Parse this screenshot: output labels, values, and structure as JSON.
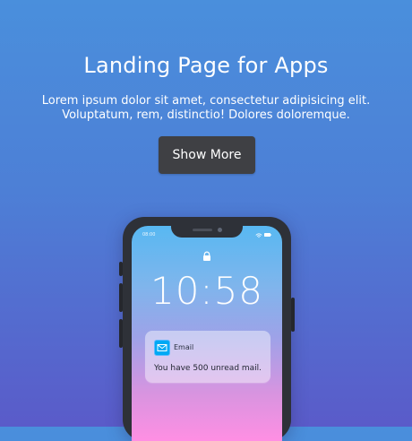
{
  "hero": {
    "title": "Landing Page for Apps",
    "subtitle": "Lorem ipsum dolor sit amet, consectetur adipisicing elit. Voluptatum, rem, distinctio! Dolores doloremque.",
    "button_label": "Show More"
  },
  "phone": {
    "status_time": "08:00",
    "time": "10:58",
    "notification": {
      "app": "Email",
      "message": "You have 500 unread mail."
    },
    "icons": {
      "status": "wifi-battery-icons",
      "lock": "lock-icon",
      "mail": "mail-icon"
    }
  },
  "colors": {
    "background_top": "#4a8fdc",
    "background_bottom": "#5a5bc9",
    "button": "#3f4044",
    "mail_accent": "#00a9f4"
  }
}
